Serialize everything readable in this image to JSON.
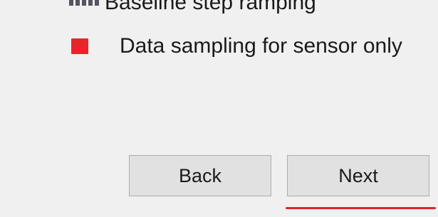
{
  "legend": {
    "items": [
      {
        "label": "Baseline step ramping",
        "icon": "dotted-line-icon",
        "color": "#55555f"
      },
      {
        "label": "Data sampling for sensor only",
        "icon": "red-square-icon",
        "color": "#e8252b"
      }
    ]
  },
  "buttons": {
    "back_label": "Back",
    "next_label": "Next"
  },
  "annotation": {
    "underline_color": "#d8282c"
  }
}
